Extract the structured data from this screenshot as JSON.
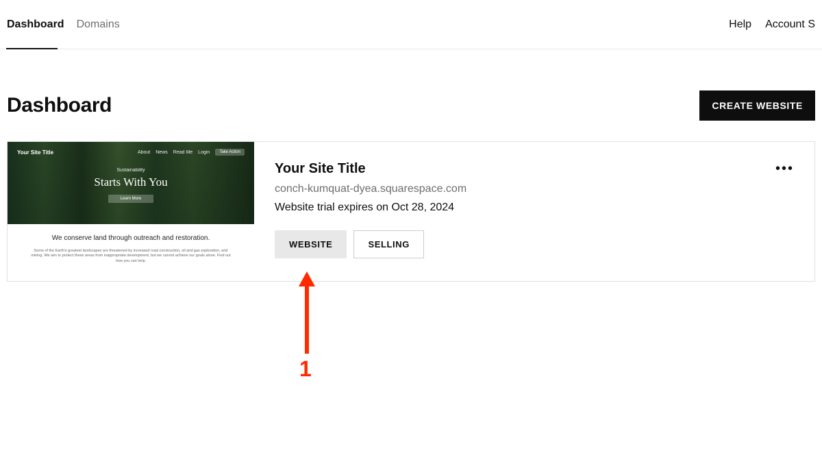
{
  "nav": {
    "tabs": [
      {
        "label": "Dashboard",
        "active": true
      },
      {
        "label": "Domains",
        "active": false
      }
    ],
    "links": {
      "help": "Help",
      "account": "Account S"
    }
  },
  "page": {
    "title": "Dashboard",
    "create_button": "CREATE WEBSITE"
  },
  "site": {
    "title": "Your Site Title",
    "domain": "conch-kumquat-dyea.squarespace.com",
    "status": "Website trial expires on Oct 28, 2024",
    "buttons": {
      "website": "WEBSITE",
      "selling": "SELLING"
    },
    "thumb": {
      "mini_title": "Your Site Title",
      "mini_links": [
        "About",
        "News",
        "Read Me",
        "Login"
      ],
      "mini_cta": "Take Action",
      "eyebrow": "Sustainability",
      "headline": "Starts With You",
      "hero_btn": "Learn More",
      "lead": "We conserve land through outreach and restoration.",
      "small": "Some of the Earth's greatest landscapes are threatened by increased road construction, oil and gas exploration, and mining. We aim to protect these areas from inappropriate development, but we cannot achieve our goals alone. Find out how you can help."
    }
  },
  "annotation": {
    "num": "1"
  }
}
